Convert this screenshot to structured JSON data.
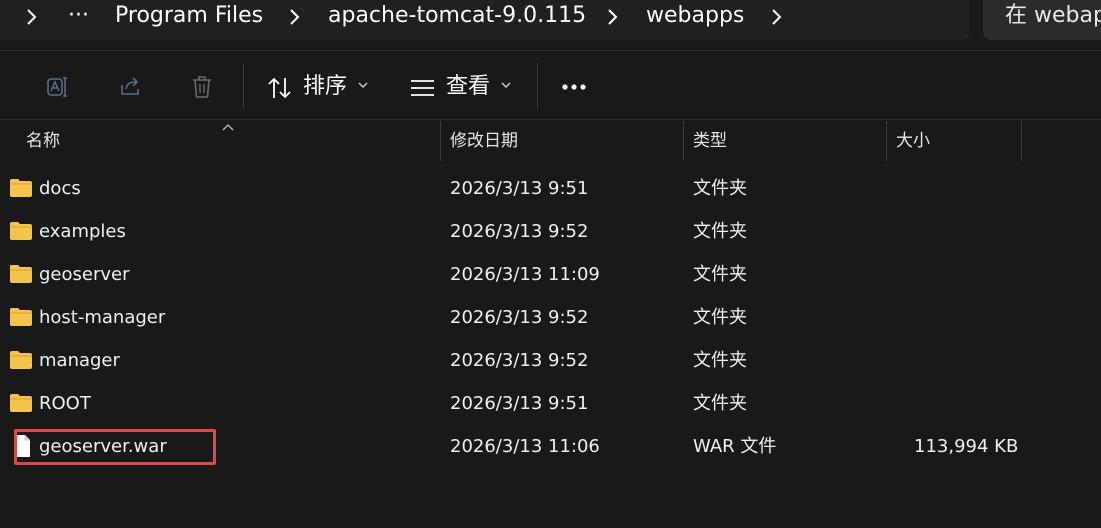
{
  "address_bar": {
    "overflow": "···",
    "crumbs": [
      "Program Files",
      "apache-tomcat-9.0.115",
      "webapps"
    ]
  },
  "search": {
    "placeholder": "在 webapps 中搜索"
  },
  "toolbar": {
    "sort_label": "排序",
    "view_label": "查看",
    "more_label": "···"
  },
  "columns": {
    "name": "名称",
    "modified": "修改日期",
    "type": "类型",
    "size": "大小"
  },
  "files": [
    {
      "name": "docs",
      "modified": "2026/3/13 9:51",
      "type": "文件夹",
      "size": "",
      "kind": "folder"
    },
    {
      "name": "examples",
      "modified": "2026/3/13 9:52",
      "type": "文件夹",
      "size": "",
      "kind": "folder"
    },
    {
      "name": "geoserver",
      "modified": "2026/3/13 11:09",
      "type": "文件夹",
      "size": "",
      "kind": "folder"
    },
    {
      "name": "host-manager",
      "modified": "2026/3/13 9:52",
      "type": "文件夹",
      "size": "",
      "kind": "folder"
    },
    {
      "name": "manager",
      "modified": "2026/3/13 9:52",
      "type": "文件夹",
      "size": "",
      "kind": "folder"
    },
    {
      "name": "ROOT",
      "modified": "2026/3/13 9:51",
      "type": "文件夹",
      "size": "",
      "kind": "folder"
    },
    {
      "name": "geoserver.war",
      "modified": "2026/3/13 11:06",
      "type": "WAR 文件",
      "size": "113,994 KB",
      "kind": "file"
    }
  ],
  "colors": {
    "background": "#191919",
    "folder": "#f4c44b",
    "highlight": "#e04848"
  }
}
